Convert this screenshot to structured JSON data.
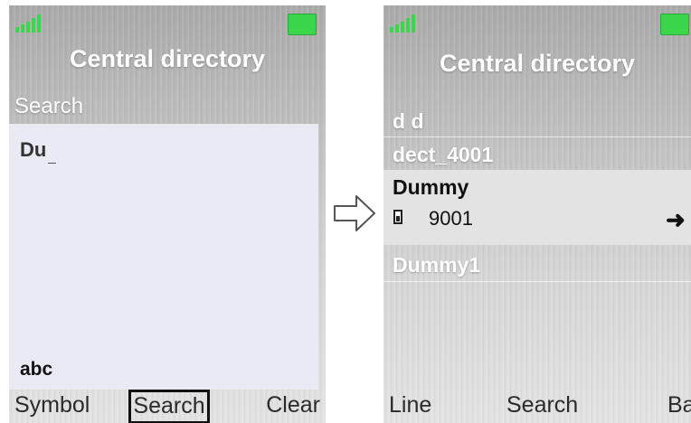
{
  "left_screen": {
    "title": "Central directory",
    "search_label": "Search",
    "search_value": "Du",
    "input_mode": "abc",
    "softkeys": {
      "left": "Symbol",
      "center": "Search",
      "right": "Clear"
    }
  },
  "right_screen": {
    "title": "Central directory",
    "entries": [
      {
        "name": "d d"
      },
      {
        "name": "dect_4001"
      },
      {
        "name": "Dummy",
        "number": "9001",
        "selected": true
      },
      {
        "name": "Dummy1"
      }
    ],
    "softkeys": {
      "left": "Line",
      "center": "Search",
      "right": "Back"
    }
  },
  "colors": {
    "signal_battery": "#3bd64c",
    "selected_row_bg": "#e3e3e3",
    "search_box_bg": "#eaeaf4"
  },
  "icons": {
    "signal": "signal-bars-icon",
    "battery": "battery-icon",
    "phone": "mobile-phone-icon",
    "arrow_right": "arrow-right-icon",
    "transition": "outline-arrow-right-icon"
  }
}
